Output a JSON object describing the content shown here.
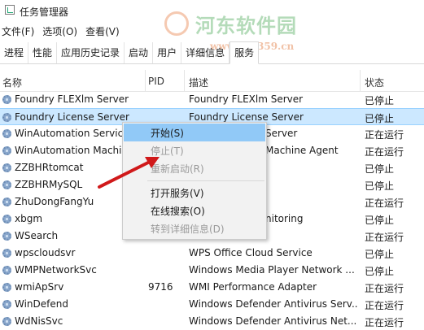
{
  "window": {
    "title": "任务管理器"
  },
  "watermark": {
    "text": "河东软件园",
    "url": "www.pc0359.cn"
  },
  "menu": [
    "文件(F)",
    "选项(O)",
    "查看(V)"
  ],
  "tabs": [
    {
      "label": "进程",
      "active": false
    },
    {
      "label": "性能",
      "active": false
    },
    {
      "label": "应用历史记录",
      "active": false
    },
    {
      "label": "启动",
      "active": false
    },
    {
      "label": "用户",
      "active": false
    },
    {
      "label": "详细信息",
      "active": false
    },
    {
      "label": "服务",
      "active": true
    }
  ],
  "columns": {
    "name": "名称",
    "pid": "PID",
    "desc": "描述",
    "status": "状态"
  },
  "rows": [
    {
      "name": "Foundry FLEXlm Server",
      "pid": "",
      "desc": "Foundry FLEXlm Server",
      "status": "已停止"
    },
    {
      "name": "Foundry License Server",
      "pid": "",
      "desc": "Foundry License Server",
      "status": "已停止",
      "selected": true
    },
    {
      "name": "WinAutomation Service",
      "pid": "",
      "desc": "Server",
      "status": "正在运行"
    },
    {
      "name": "WinAutomation Machine",
      "pid": "",
      "desc": "Machine Agent",
      "status": "正在运行"
    },
    {
      "name": "ZZBHRtomcat",
      "pid": "",
      "desc": "",
      "status": "已停止"
    },
    {
      "name": "ZZBHRMySQL",
      "pid": "",
      "desc": "",
      "status": "已停止"
    },
    {
      "name": "ZhuDongFangYu",
      "pid": "",
      "desc": "",
      "status": "正在运行"
    },
    {
      "name": "xbgm",
      "pid": "",
      "desc": "nitoring",
      "status": "已停止"
    },
    {
      "name": "WSearch",
      "pid": "",
      "desc": "",
      "status": "正在运行"
    },
    {
      "name": "wpscloudsvr",
      "pid": "",
      "desc": "WPS Office Cloud Service",
      "status": "已停止"
    },
    {
      "name": "WMPNetworkSvc",
      "pid": "",
      "desc": "Windows Media Player Network ...",
      "status": "已停止"
    },
    {
      "name": "wmiApSrv",
      "pid": "9716",
      "desc": "WMI Performance Adapter",
      "status": "正在运行"
    },
    {
      "name": "WinDefend",
      "pid": "",
      "desc": "Windows Defender Antivirus Serv...",
      "status": "正在运行"
    },
    {
      "name": "WdNisSvc",
      "pid": "",
      "desc": "Windows Defender Antivirus Net...",
      "status": "正在运行"
    }
  ],
  "context_menu": [
    {
      "label": "开始(S)",
      "state": "hover"
    },
    {
      "label": "停止(T)",
      "state": "disabled"
    },
    {
      "label": "重新启动(R)",
      "state": "disabled"
    },
    {
      "label": "打开服务(V)",
      "state": "normal"
    },
    {
      "label": "在线搜索(O)",
      "state": "normal"
    },
    {
      "label": "转到详细信息(D)",
      "state": "disabled"
    }
  ],
  "colors": {
    "selection": "#cce8ff",
    "menu_hover": "#91c9f7",
    "arrow": "#d0191a"
  }
}
